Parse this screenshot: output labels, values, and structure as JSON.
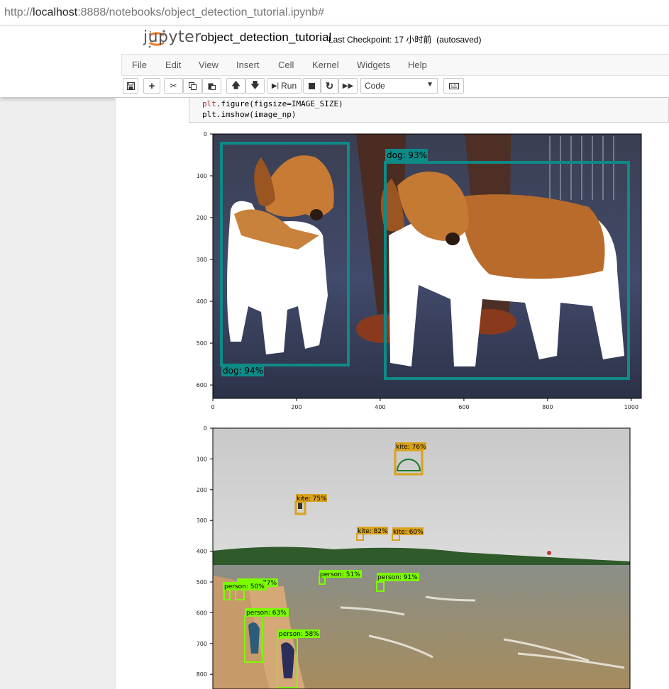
{
  "browser": {
    "url_prefix": "http://",
    "url_host": "localhost",
    "url_rest": ":8888/notebooks/object_detection_tutorial.ipynb#"
  },
  "header": {
    "logo_text": "jupyter",
    "notebook_name": "object_detection_tutorial",
    "checkpoint_label": "Last Checkpoint:",
    "checkpoint_time": "17 小时前",
    "autosave": "(autosaved)"
  },
  "menu": [
    "File",
    "Edit",
    "View",
    "Insert",
    "Cell",
    "Kernel",
    "Widgets",
    "Help"
  ],
  "toolbar": {
    "run_label": "Run",
    "cell_type": "Code"
  },
  "code": {
    "line1_obj": "plt",
    "line1_rest": ".figure(figsize=IMAGE_SIZE)",
    "line2": "plt.imshow(image_np)"
  },
  "plot1": {
    "xticks": [
      "0",
      "200",
      "400",
      "600",
      "800",
      "1000"
    ],
    "yticks": [
      "0",
      "100",
      "200",
      "300",
      "400",
      "500",
      "600"
    ],
    "box_color": "#0e8a87",
    "detections": [
      {
        "label": "dog: 94%"
      },
      {
        "label": "dog: 93%"
      }
    ]
  },
  "plot2": {
    "yticks": [
      "0",
      "100",
      "200",
      "300",
      "400",
      "500",
      "600",
      "700",
      "800"
    ],
    "kite_color": "#d9a21b",
    "person_color": "#7cfc00",
    "kites": [
      {
        "label": "kite: 76%"
      },
      {
        "label": "kite: 75%"
      },
      {
        "label": "kite: 82%"
      },
      {
        "label": "kite: 60%"
      }
    ],
    "persons": [
      {
        "label": "person: 51%"
      },
      {
        "label": "person: 91%"
      },
      {
        "label": "person: 50%"
      },
      {
        "label": "77%"
      },
      {
        "label": "person: 63%"
      },
      {
        "label": "person: 58%"
      }
    ]
  }
}
